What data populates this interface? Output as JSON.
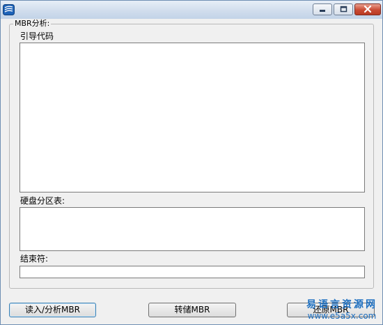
{
  "window": {
    "icon": "app-logo-icon",
    "controls": [
      "minimize-icon",
      "maximize-icon",
      "close-icon"
    ]
  },
  "group": {
    "caption": "MBR分析:",
    "boot_code_label": "引导代码",
    "boot_code_value": "",
    "partition_table_label": "硬盘分区表:",
    "partition_table_value": "",
    "end_marker_label": "结束符:",
    "end_marker_value": ""
  },
  "buttons": {
    "read": "读入/分析MBR",
    "dump": "转储MBR",
    "restore": "还原MBR"
  },
  "watermark": {
    "title": "易语言资源网",
    "url": "www.e5a5x.com"
  }
}
